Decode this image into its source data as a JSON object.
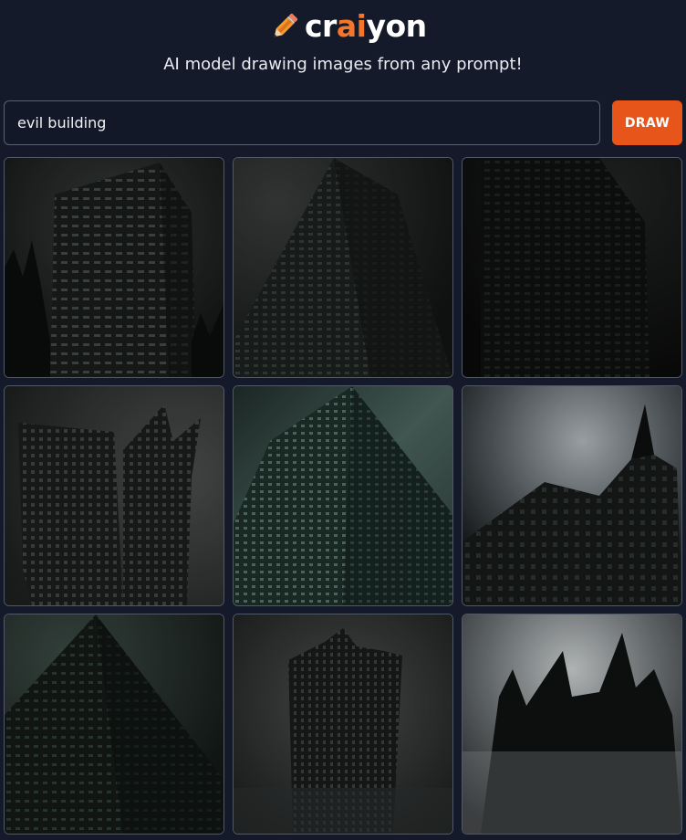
{
  "header": {
    "logo": {
      "prefix": "cr",
      "accent": "ai",
      "suffix": "yon",
      "icon": "pencil-icon"
    },
    "tagline": "AI model drawing images from any prompt!"
  },
  "search": {
    "value": "evil building",
    "placeholder": ""
  },
  "draw_button": {
    "label": "DRAW"
  },
  "colors": {
    "background": "#141a2a",
    "accent": "#e8551a",
    "logo_accent": "#f4762a",
    "input_border": "#5a6072"
  },
  "images": [
    {
      "subject": "dark tower with trees"
    },
    {
      "subject": "tall dark building from below"
    },
    {
      "subject": "very dark building"
    },
    {
      "subject": "twin towers with spires"
    },
    {
      "subject": "green-tinted skyscraper"
    },
    {
      "subject": "dark castle roof under cloudy sky"
    },
    {
      "subject": "dark green building corner"
    },
    {
      "subject": "tall tower in fog"
    },
    {
      "subject": "gothic spires in mist"
    }
  ]
}
